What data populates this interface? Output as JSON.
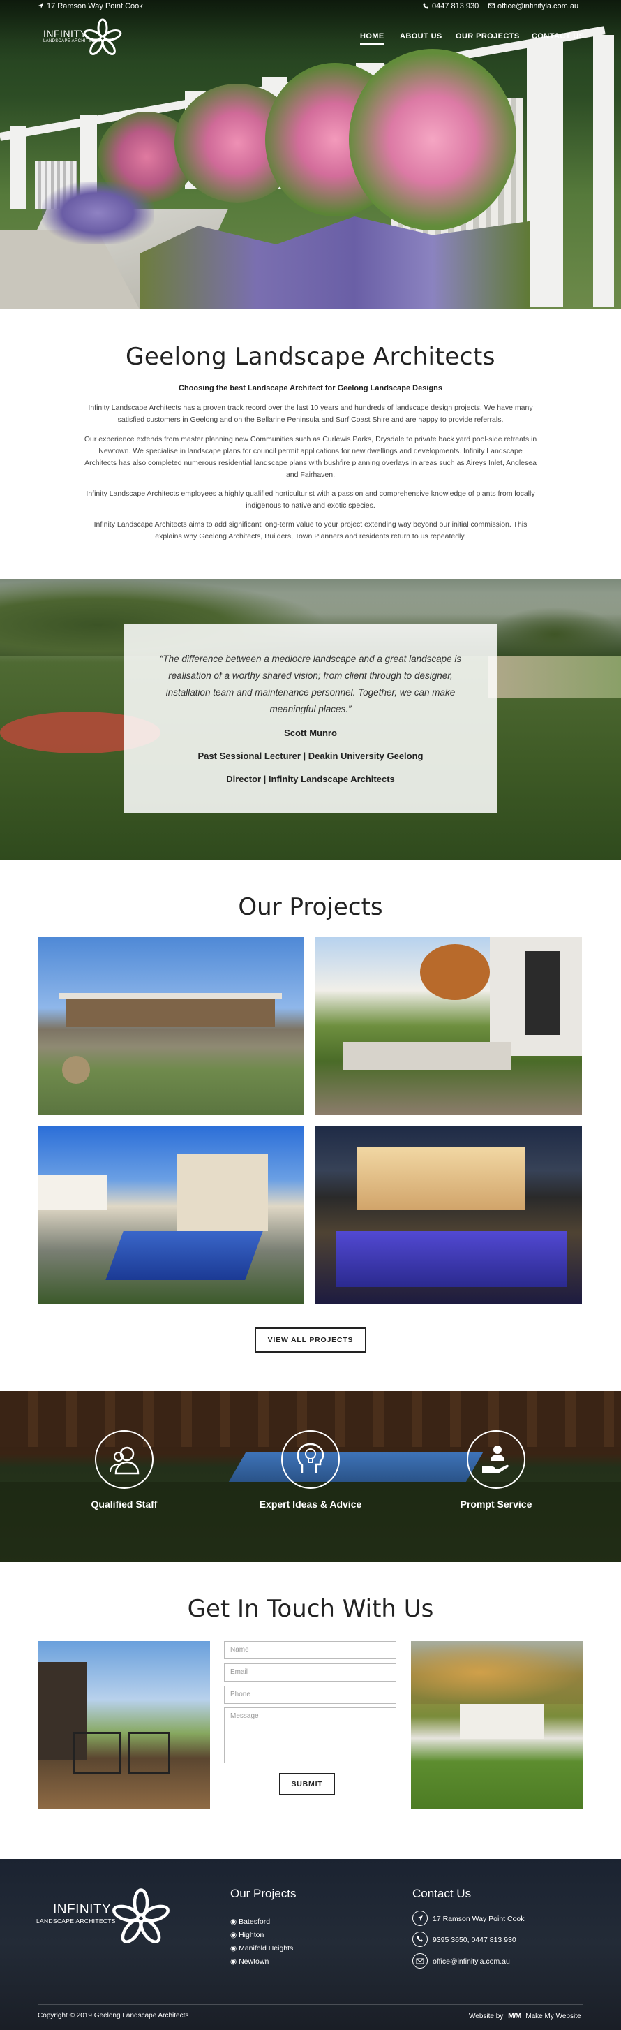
{
  "topbar": {
    "address": "17 Ramson Way Point Cook",
    "phone": "0447 813 930",
    "email": "office@infinityla.com.au"
  },
  "logo": {
    "title": "INFINITY",
    "subtitle": "LANDSCAPE ARCHITECTS"
  },
  "nav": [
    {
      "label": "HOME",
      "active": true
    },
    {
      "label": "ABOUT US",
      "active": false
    },
    {
      "label": "OUR PROJECTS",
      "active": false
    },
    {
      "label": "CONTACT US",
      "active": false
    }
  ],
  "intro": {
    "title": "Geelong Landscape Architects",
    "subtitle": "Choosing the best Landscape Architect for Geelong Landscape Designs",
    "paragraphs": [
      "Infinity Landscape Architects has a proven track record over the last 10 years and hundreds of landscape design projects. We have many satisfied customers in Geelong and on the Bellarine Peninsula and Surf Coast Shire and are happy to provide referrals.",
      "Our experience extends from master planning new Communities such as Curlewis Parks, Drysdale to private back yard pool-side retreats in Newtown. We specialise in landscape plans for council permit applications for new dwellings and developments. Infinity Landscape Architects has also completed numerous residential landscape plans with bushfire planning overlays in areas such as Aireys Inlet, Anglesea and Fairhaven.",
      "Infinity Landscape Architects employees a highly qualified horticulturist with a passion and comprehensive knowledge of plants from locally indigenous to native and exotic species.",
      "Infinity Landscape Architects aims to add significant long-term value to your project extending way beyond our initial commission. This explains why Geelong Architects, Builders, Town Planners and residents return to us repeatedly."
    ]
  },
  "quote": {
    "text": "“The difference between a mediocre landscape and a great landscape is realisation of a worthy shared vision; from client through to designer, installation team and maintenance personnel. Together, we can make meaningful places.”",
    "name": "Scott Munro",
    "role1": "Past Sessional Lecturer | Deakin University Geelong",
    "role2": "Director | Infinity Landscape Architects"
  },
  "projects": {
    "title": "Our Projects",
    "button": "VIEW ALL PROJECTS"
  },
  "services": [
    {
      "label": "Qualified Staff",
      "icon": "staff-icon"
    },
    {
      "label": "Expert Ideas & Advice",
      "icon": "lightbulb-head-icon"
    },
    {
      "label": "Prompt Service",
      "icon": "hand-user-icon"
    }
  ],
  "contact": {
    "title": "Get In Touch With Us",
    "name_placeholder": "Name",
    "email_placeholder": "Email",
    "phone_placeholder": "Phone",
    "message_placeholder": "Message",
    "submit": "SUBMIT"
  },
  "footer": {
    "projects_title": "Our Projects",
    "project_links": [
      "Batesford",
      "Highton",
      "Manifold Heights",
      "Newtown"
    ],
    "contact_title": "Contact Us",
    "address": "17 Ramson Way Point Cook",
    "phones": "9395 3650, 0447 813 930",
    "email": "office@infinityla.com.au",
    "copyright": "Copyright © 2019 Geelong Landscape Architects",
    "credit_prefix": "Website by",
    "credit_name": "Make My Website"
  }
}
